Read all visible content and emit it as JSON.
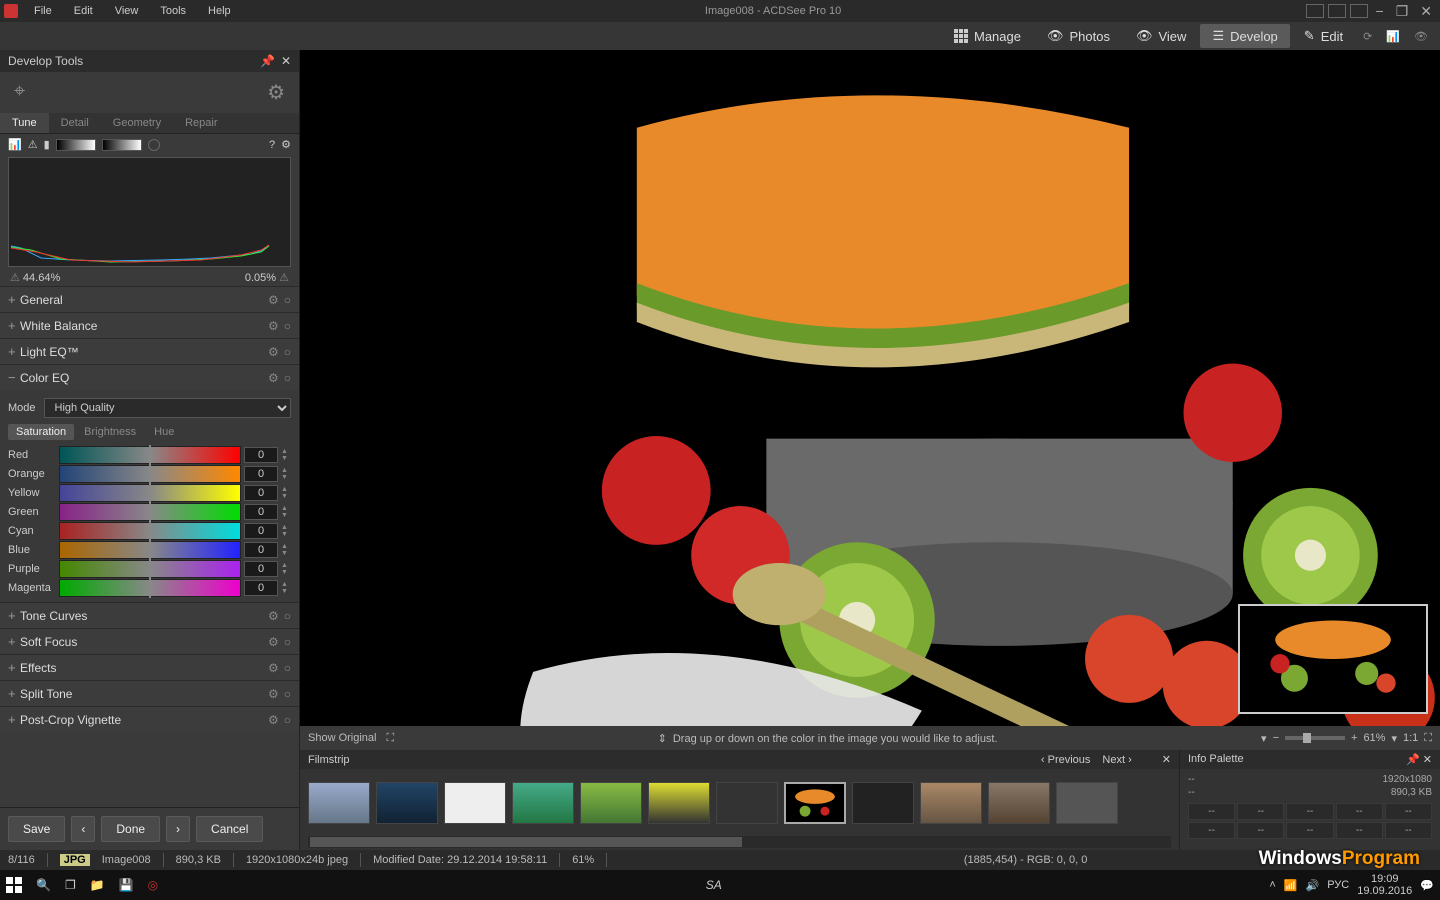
{
  "title": "Image008 - ACDSee Pro 10",
  "menubar": [
    "File",
    "Edit",
    "View",
    "Tools",
    "Help"
  ],
  "modes": {
    "manage": "Manage",
    "photos": "Photos",
    "view": "View",
    "develop": "Develop",
    "edit": "Edit"
  },
  "panel": {
    "title": "Develop Tools",
    "tabs": {
      "tune": "Tune",
      "detail": "Detail",
      "geometry": "Geometry",
      "repair": "Repair"
    },
    "hist_left": "44.64%",
    "hist_right": "0.05%",
    "sections": {
      "general": "General",
      "wb": "White Balance",
      "lighteq": "Light EQ™",
      "coloreq": "Color EQ",
      "tone": "Tone Curves",
      "soft": "Soft Focus",
      "effects": "Effects",
      "split": "Split Tone",
      "vignette": "Post-Crop Vignette"
    },
    "coloreq": {
      "mode_label": "Mode",
      "mode_value": "High Quality",
      "subtabs": {
        "sat": "Saturation",
        "bri": "Brightness",
        "hue": "Hue"
      },
      "sliders": [
        {
          "name": "Red",
          "val": "0",
          "cls": "red"
        },
        {
          "name": "Orange",
          "val": "0",
          "cls": "orange"
        },
        {
          "name": "Yellow",
          "val": "0",
          "cls": "yellow"
        },
        {
          "name": "Green",
          "val": "0",
          "cls": "green"
        },
        {
          "name": "Cyan",
          "val": "0",
          "cls": "cyan"
        },
        {
          "name": "Blue",
          "val": "0",
          "cls": "blue"
        },
        {
          "name": "Purple",
          "val": "0",
          "cls": "purple"
        },
        {
          "name": "Magenta",
          "val": "0",
          "cls": "magenta"
        }
      ]
    },
    "save": "Save",
    "done": "Done",
    "cancel": "Cancel"
  },
  "canvas": {
    "show_original": "Show Original",
    "hint": "Drag up or down on the color in the image you would like to adjust.",
    "zoom": "61%",
    "ratio": "1:1"
  },
  "filmstrip": {
    "title": "Filmstrip",
    "prev": "Previous",
    "next": "Next"
  },
  "infopalette": {
    "title": "Info Palette",
    "dims": "1920x1080",
    "size": "890,3 KB",
    "dash": "--"
  },
  "status": {
    "counter": "8/116",
    "format": "JPG",
    "name": "Image008",
    "size": "890,3 KB",
    "dims": "1920x1080x24b jpeg",
    "modified": "Modified Date: 29.12.2014 19:58:11",
    "zoom": "61%",
    "cursor": "(1885,454) - RGB: 0, 0, 0"
  },
  "taskbar": {
    "time": "19:09",
    "date": "19.09.2016",
    "lang": "РУС",
    "sa": "SA"
  },
  "watermark": {
    "a": "Windows",
    "b": "Program"
  }
}
